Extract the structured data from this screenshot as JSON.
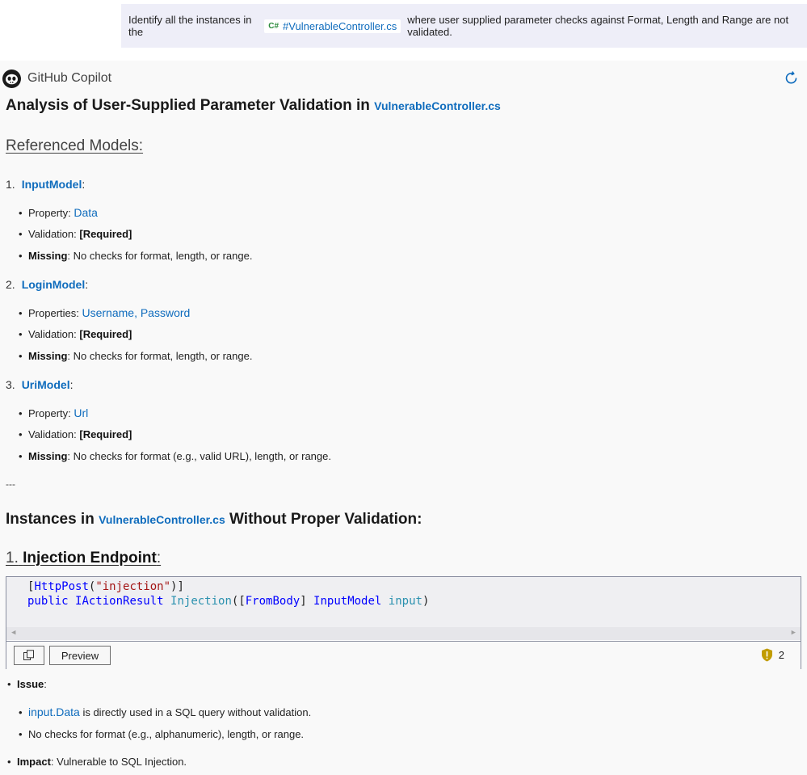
{
  "user_message": {
    "prefix": "Identify all the instances in the",
    "ref_lang": "C#",
    "ref_file": "#VulnerableController.cs",
    "suffix": "where user supplied parameter checks against Format, Length and Range are not validated."
  },
  "response": {
    "author": "GitHub Copilot",
    "title_prefix": "Analysis of User-Supplied Parameter Validation in",
    "title_file": "VulnerableController.cs",
    "referenced_heading": "Referenced Models:",
    "models": [
      {
        "num": "1.",
        "name": "InputModel",
        "prop_label": "Property: ",
        "props": "Data",
        "validation_label": "Validation: ",
        "validation": "[Required]",
        "missing_label": "Missing",
        "missing": ": No checks for format, length, or range."
      },
      {
        "num": "2.",
        "name": "LoginModel",
        "prop_label": "Properties: ",
        "props": "Username, Password",
        "validation_label": "Validation: ",
        "validation": "[Required]",
        "missing_label": "Missing",
        "missing": ": No checks for format, length, or range."
      },
      {
        "num": "3.",
        "name": "UriModel",
        "prop_label": "Property: ",
        "props": "Url",
        "validation_label": "Validation: ",
        "validation": "[Required]",
        "missing_label": "Missing",
        "missing": ": No checks for format (e.g., valid URL), length, or range."
      }
    ],
    "separator": "---",
    "instances_prefix": "Instances in",
    "instances_file": "VulnerableController.cs",
    "instances_suffix": "Without Proper Validation:",
    "sub1_num": "1.",
    "sub1_title": "Injection Endpoint",
    "sub1_colon": ":",
    "code": {
      "l1_open": "[",
      "l1_attr": "HttpPost",
      "l1_paren": "(",
      "l1_str": "\"injection\"",
      "l1_close": ")]",
      "l2_kw": "public",
      "l2_type": "IActionResult",
      "l2_method": "Injection",
      "l2_p1": "([",
      "l2_attr": "FromBody",
      "l2_p2": "] ",
      "l2_ptype": "InputModel",
      "l2_param": "input",
      "l2_end": ")"
    },
    "preview_label": "Preview",
    "warning_count": "2",
    "issue_label": "Issue",
    "issue_colon": ":",
    "issue_items": [
      {
        "link": "input.Data",
        "text": " is directly used in a SQL query without validation."
      },
      {
        "text": "No checks for format (e.g., alphanumeric), length, or range."
      }
    ],
    "impact_label": "Impact",
    "impact_text": ": Vulnerable to SQL Injection."
  },
  "colors": {
    "link": "#0f6cbd",
    "user_bubble": "#eeeef8",
    "response_bg": "#f9f9f9",
    "warning": "#c19c00"
  }
}
